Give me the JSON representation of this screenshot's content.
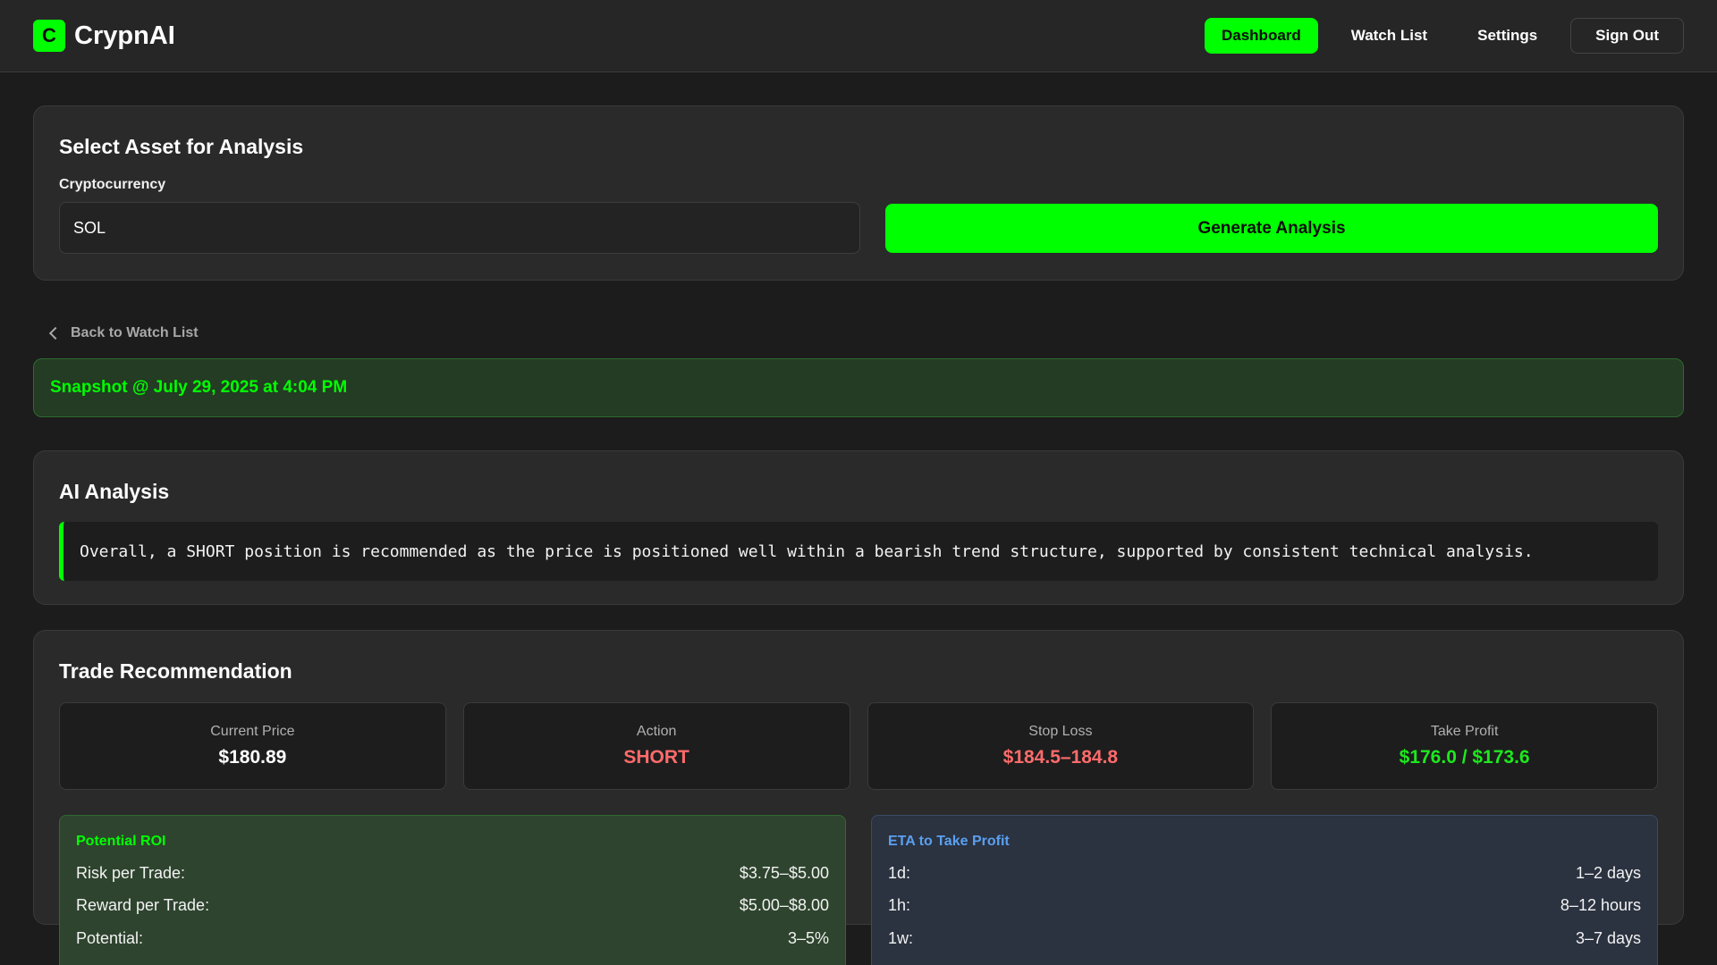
{
  "header": {
    "logo_letter": "C",
    "brand": "CrypnAI",
    "nav": {
      "dashboard": "Dashboard",
      "watch_list": "Watch List",
      "settings": "Settings",
      "sign_out": "Sign Out"
    }
  },
  "asset": {
    "title": "Select Asset for Analysis",
    "field_label": "Cryptocurrency",
    "value": "SOL",
    "button": "Generate Analysis"
  },
  "back_link": "Back to Watch List",
  "snapshot": "Snapshot @ July 29, 2025 at 4:04 PM",
  "ai": {
    "title": "AI Analysis",
    "text": "Overall, a SHORT position is recommended as the price is positioned well within a bearish trend structure, supported by consistent technical analysis."
  },
  "trade": {
    "title": "Trade Recommendation",
    "metrics": [
      {
        "label": "Current Price",
        "value": "$180.89"
      },
      {
        "label": "Action",
        "value": "SHORT"
      },
      {
        "label": "Stop Loss",
        "value": "$184.5–184.8"
      },
      {
        "label": "Take Profit",
        "value": "$176.0 / $173.6"
      }
    ],
    "roi": {
      "title": "Potential ROI",
      "rows": [
        {
          "label": "Risk per Trade:",
          "value": "$3.75–$5.00"
        },
        {
          "label": "Reward per Trade:",
          "value": "$5.00–$8.00"
        },
        {
          "label": "Potential:",
          "value": "3–5%"
        }
      ]
    },
    "eta": {
      "title": "ETA to Take Profit",
      "rows": [
        {
          "label": "1d:",
          "value": "1–2 days"
        },
        {
          "label": "1h:",
          "value": "8–12 hours"
        },
        {
          "label": "1w:",
          "value": "3–7 days"
        }
      ]
    }
  },
  "colors": {
    "accent": "#00ff00",
    "danger": "#ff6b6b",
    "info": "#5aa0f0",
    "background": "#1c1c1c"
  }
}
